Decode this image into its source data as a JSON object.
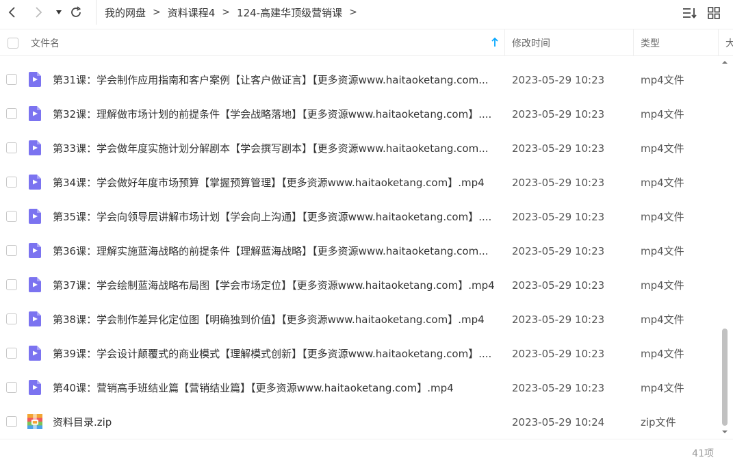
{
  "breadcrumb": [
    "我的网盘",
    "资料课程4",
    "124-高建华顶级营销课"
  ],
  "columns": {
    "name": "文件名",
    "modified": "修改时间",
    "type": "类型",
    "size": "大"
  },
  "files": [
    {
      "name": "第31课：学会制作应用指南和客户案例【让客户做证言】【更多资源www.haitaoketang.com...",
      "modified": "2023-05-29 10:23",
      "type": "mp4文件",
      "icon": "video-file-icon"
    },
    {
      "name": "第32课：理解做市场计划的前提条件【学会战略落地】【更多资源www.haitaoketang.com】....",
      "modified": "2023-05-29 10:23",
      "type": "mp4文件",
      "icon": "video-file-icon"
    },
    {
      "name": "第33课：学会做年度实施计划分解剧本【学会撰写剧本】【更多资源www.haitaoketang.com...",
      "modified": "2023-05-29 10:23",
      "type": "mp4文件",
      "icon": "video-file-icon"
    },
    {
      "name": "第34课：学会做好年度市场预算【掌握预算管理】【更多资源www.haitaoketang.com】.mp4",
      "modified": "2023-05-29 10:23",
      "type": "mp4文件",
      "icon": "video-file-icon"
    },
    {
      "name": "第35课：学会向领导层讲解市场计划【学会向上沟通】【更多资源www.haitaoketang.com】....",
      "modified": "2023-05-29 10:23",
      "type": "mp4文件",
      "icon": "video-file-icon"
    },
    {
      "name": "第36课：理解实施蓝海战略的前提条件【理解蓝海战略】【更多资源www.haitaoketang.com...",
      "modified": "2023-05-29 10:23",
      "type": "mp4文件",
      "icon": "video-file-icon"
    },
    {
      "name": "第37课：学会绘制蓝海战略布局图【学会市场定位】【更多资源www.haitaoketang.com】.mp4",
      "modified": "2023-05-29 10:23",
      "type": "mp4文件",
      "icon": "video-file-icon"
    },
    {
      "name": "第38课：学会制作差异化定位图【明确独到价值】【更多资源www.haitaoketang.com】.mp4",
      "modified": "2023-05-29 10:23",
      "type": "mp4文件",
      "icon": "video-file-icon"
    },
    {
      "name": "第39课：学会设计颠覆式的商业模式【理解模式创新】【更多资源www.haitaoketang.com】....",
      "modified": "2023-05-29 10:23",
      "type": "mp4文件",
      "icon": "video-file-icon"
    },
    {
      "name": "第40课：营销高手班结业篇【营销结业篇】【更多资源www.haitaoketang.com】.mp4",
      "modified": "2023-05-29 10:23",
      "type": "mp4文件",
      "icon": "video-file-icon"
    },
    {
      "name": "资料目录.zip",
      "modified": "2023-05-29 10:24",
      "type": "zip文件",
      "icon": "zip-file-icon"
    }
  ],
  "item_count": "41项",
  "colors": {
    "video_icon": "#7b73f0",
    "accent": "#06a7ff",
    "text": "#333333",
    "muted": "#999999"
  }
}
